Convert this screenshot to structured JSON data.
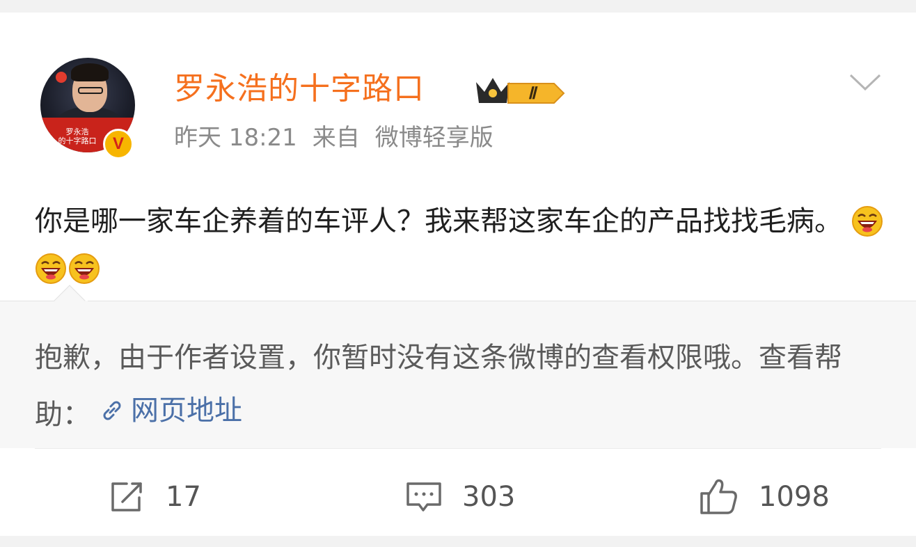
{
  "post": {
    "author": {
      "name": "罗永浩的十字路口",
      "avatar_caption": "罗永浩\n的十字路口",
      "verified_badge": "V",
      "member_badge": "Ⅱ"
    },
    "meta": {
      "time": "昨天 18:21",
      "source_prefix": "来自",
      "source": "微博轻享版"
    },
    "text": "你是哪一家车企养着的车评人？我来帮这家车企的产品找找毛病。",
    "emojis": [
      "laughing-emoji",
      "laughing-emoji",
      "laughing-emoji"
    ]
  },
  "notice": {
    "text": "抱歉，由于作者设置，你暂时没有这条微博的查看权限哦。查看帮助：",
    "link_label": "网页地址"
  },
  "actions": {
    "repost_count": "17",
    "comment_count": "303",
    "like_count": "1098"
  },
  "colors": {
    "username": "#f5701e",
    "link": "#4b70a8",
    "badge_gold": "#f7b500"
  }
}
